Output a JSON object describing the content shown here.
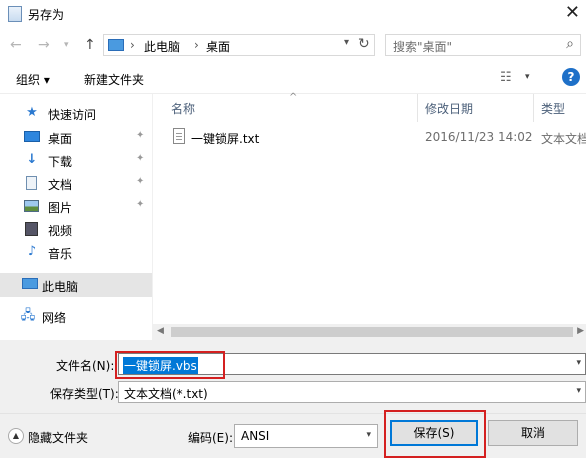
{
  "window": {
    "title": "另存为"
  },
  "address": {
    "crumbs": [
      "此电脑",
      "桌面"
    ]
  },
  "search": {
    "placeholder": "搜索\"桌面\""
  },
  "toolbar": {
    "organize": "组织 ▾",
    "new_folder": "新建文件夹"
  },
  "sidebar": {
    "items": [
      {
        "label": "快速访问",
        "icon": "star-icon"
      },
      {
        "label": "桌面",
        "icon": "desktop-icon",
        "pinned": true
      },
      {
        "label": "下载",
        "icon": "download-icon",
        "pinned": true
      },
      {
        "label": "文档",
        "icon": "document-icon",
        "pinned": true
      },
      {
        "label": "图片",
        "icon": "picture-icon",
        "pinned": true
      },
      {
        "label": "视频",
        "icon": "video-icon"
      },
      {
        "label": "音乐",
        "icon": "music-icon"
      },
      {
        "label": "此电脑",
        "icon": "computer-icon",
        "selected": true
      },
      {
        "label": "网络",
        "icon": "network-icon"
      }
    ]
  },
  "columns": {
    "name": "名称",
    "date": "修改日期",
    "type": "类型"
  },
  "files": [
    {
      "name": "一键锁屏.txt",
      "date": "2016/11/23 14:02",
      "type": "文本文档"
    }
  ],
  "form": {
    "filename_label": "文件名(N):",
    "filename_value": "一键锁屏.vbs",
    "filetype_label": "保存类型(T):",
    "filetype_value": "文本文档(*.txt)",
    "hide_folders": "隐藏文件夹",
    "encoding_label": "编码(E):",
    "encoding_value": "ANSI",
    "save": "保存(S)",
    "cancel": "取消"
  },
  "colors": {
    "selection": "#0078d7",
    "highlight": "#d42020",
    "sidebar_selected": "#e5e5e5"
  }
}
